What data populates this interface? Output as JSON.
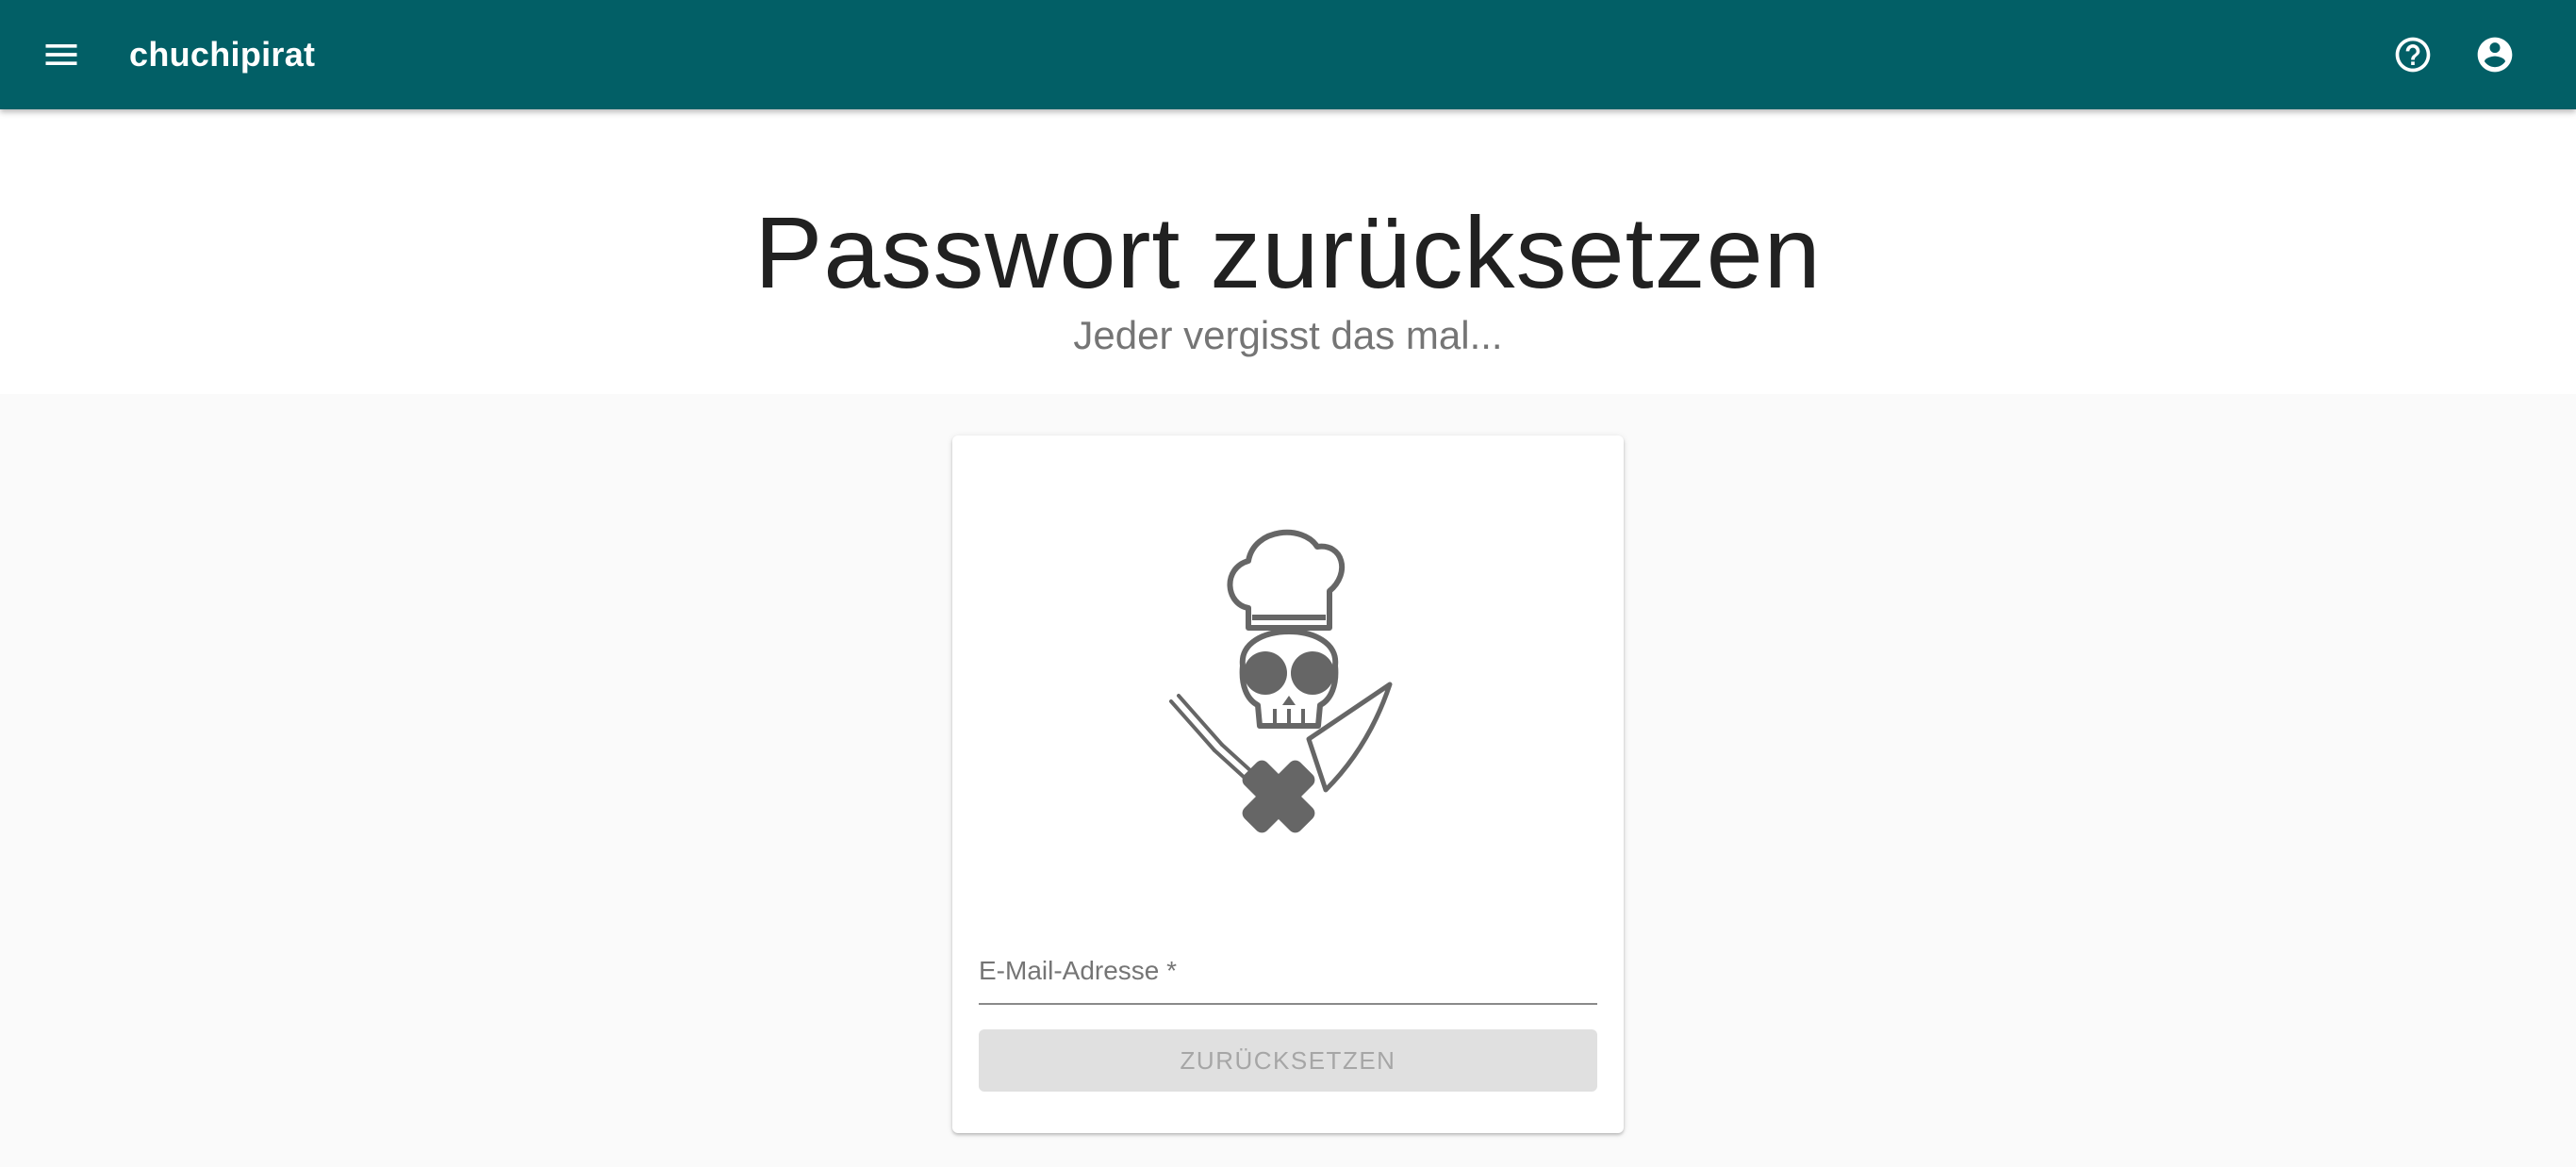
{
  "appbar": {
    "title": "chuchipirat",
    "menu_icon": "menu-icon",
    "help_icon": "help-circle-icon",
    "account_icon": "account-circle-icon",
    "color": "#025f66"
  },
  "hero": {
    "title": "Passwort zurücksetzen",
    "subtitle": "Jeder vergisst das mal..."
  },
  "card": {
    "logo": "chef-skull-fork-knife-logo",
    "email_label": "E-Mail-Adresse *",
    "submit_label": "ZURÜCKSETZEN",
    "submit_disabled": true
  }
}
